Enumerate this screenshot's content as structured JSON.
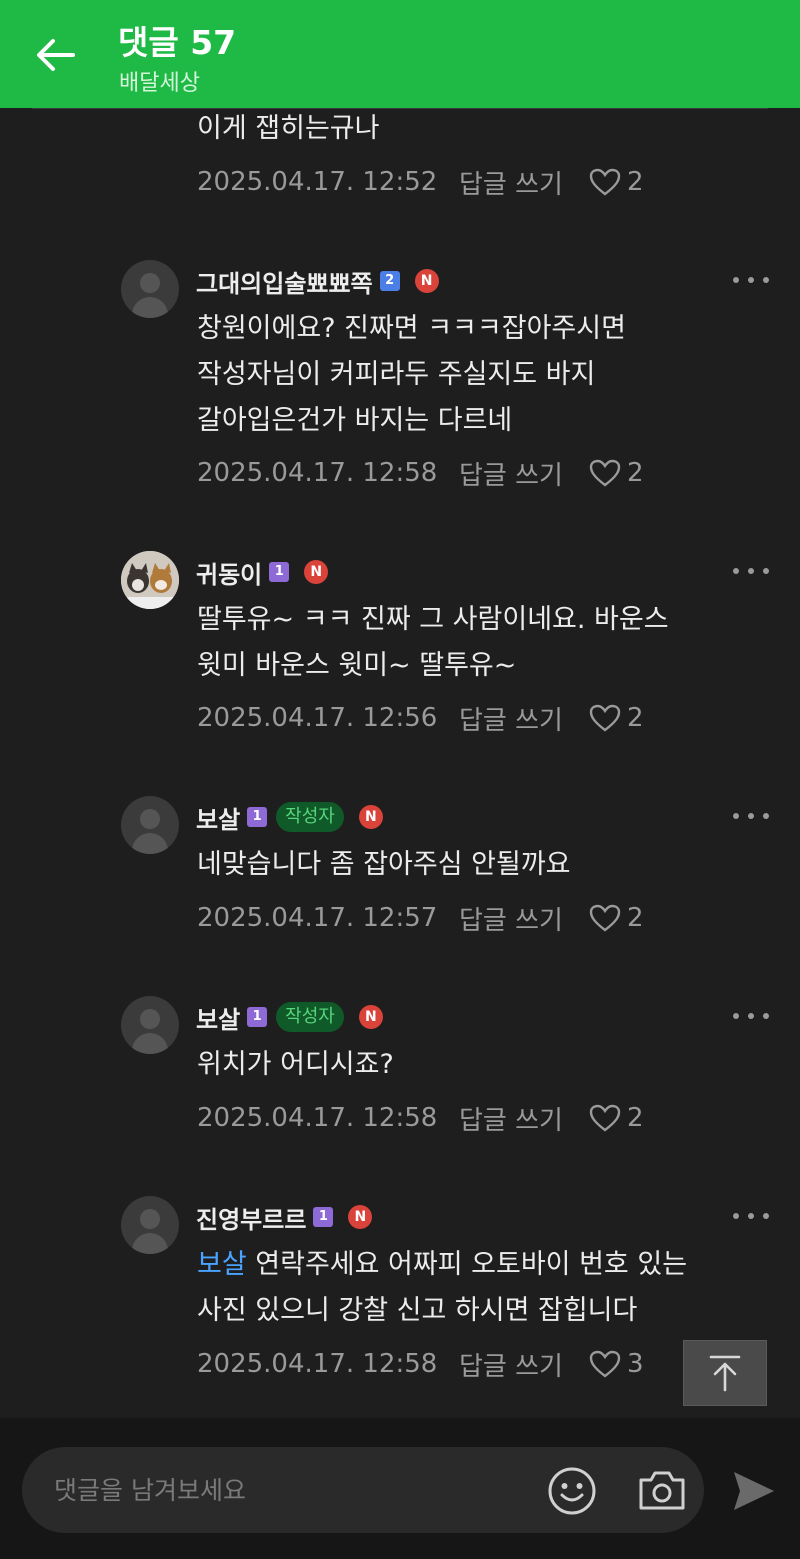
{
  "header": {
    "title": "댓글 57",
    "subtitle": "배달세상"
  },
  "comments": [
    {
      "text": "이게 잽히는규나",
      "date": "2025.04.17. 12:52",
      "reply_label": "답글 쓰기",
      "likes": "2"
    },
    {
      "nickname": "그대의입술뾰뾰쪽",
      "level": "2",
      "n_badge": "N",
      "text": "창원이에요? 진짜면 ㅋㅋㅋ잡아주시면\n작성자님이 커피라두 주실지도 바지\n갈아입은건가 바지는 다르네",
      "date": "2025.04.17. 12:58",
      "reply_label": "답글 쓰기",
      "likes": "2"
    },
    {
      "nickname": "귀동이",
      "level": "1",
      "n_badge": "N",
      "text": "딸투유~ ㅋㅋ 진짜 그 사람이네요. 바운스\n윗미 바운스 윗미~ 딸투유~",
      "date": "2025.04.17. 12:56",
      "reply_label": "답글 쓰기",
      "likes": "2"
    },
    {
      "nickname": "보살",
      "level": "1",
      "author_badge": "작성자",
      "n_badge": "N",
      "text": "네맞습니다 좀 잡아주심 안될까요",
      "date": "2025.04.17. 12:57",
      "reply_label": "답글 쓰기",
      "likes": "2"
    },
    {
      "nickname": "보살",
      "level": "1",
      "author_badge": "작성자",
      "n_badge": "N",
      "text": "위치가 어디시죠?",
      "date": "2025.04.17. 12:58",
      "reply_label": "답글 쓰기",
      "likes": "2"
    },
    {
      "nickname": "진영부르르",
      "level": "1",
      "n_badge": "N",
      "mention": "보살",
      "text": " 연락주세요 어짜피 오토바이 번호 있는\n사진 있으니 강찰 신고 하시면 잡힙니다",
      "date": "2025.04.17. 12:58",
      "reply_label": "답글 쓰기",
      "likes": "3"
    }
  ],
  "composer": {
    "placeholder": "댓글을 남겨보세요"
  },
  "icons": {
    "back": "arrow-left-icon",
    "more": "more-dots-icon",
    "like": "heart-outline-icon",
    "scroll_top": "arrow-up-icon",
    "emoji": "smiley-icon",
    "camera": "camera-icon",
    "send": "send-icon"
  },
  "colors": {
    "header_bg": "#1fba45",
    "background": "#1e1e1e",
    "mention": "#4aa3ff",
    "author_badge_bg": "#0f5a28",
    "author_badge_text": "#58d47d",
    "n_badge": "#d9433a"
  }
}
